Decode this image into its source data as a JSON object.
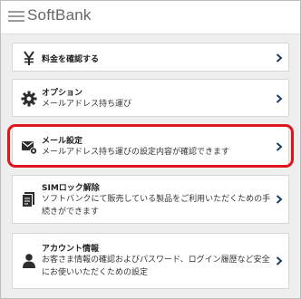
{
  "header": {
    "logo_text": "SoftBank"
  },
  "menu": [
    {
      "title": "料金を確認する",
      "desc": ""
    },
    {
      "title": "オプション",
      "desc": "メールアドレス持ち運び"
    },
    {
      "title": "メール設定",
      "desc": "メールアドレス持ち運びの設定内容が確認できます"
    },
    {
      "title": "SIMロック解除",
      "desc": "ソフトバンクにて販売している製品をご利用いただくための手続きができます"
    },
    {
      "title": "アカウント情報",
      "desc": "お客さま情報の確認およびパスワード、ログイン履歴など安全にお使いいただくための設定"
    }
  ],
  "colors": {
    "chevron": "#1a3f66",
    "icon": "#2e2e2e",
    "highlight": "#e0141b"
  },
  "icons": [
    "yen-icon",
    "gear-icon",
    "mail-settings-icon",
    "document-icon",
    "person-icon"
  ]
}
